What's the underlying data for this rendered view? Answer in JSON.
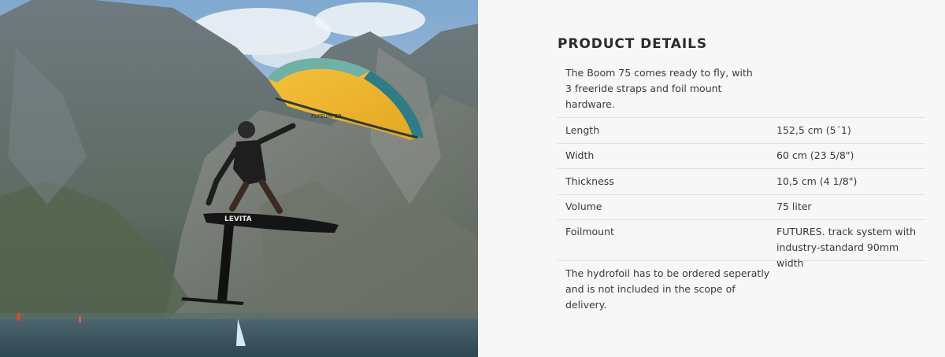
{
  "hero": {
    "board_brand": "LEVITA",
    "wing_brand": "FLYSURFER"
  },
  "details": {
    "title": "PRODUCT DETAILS",
    "intro": "The Boom 75 comes ready to fly, with 3 freeride straps and foil mount hardware.",
    "specs": [
      {
        "label": "Length",
        "value": "152,5 cm (5´1)"
      },
      {
        "label": "Width",
        "value": "60 cm (23 5/8\")"
      },
      {
        "label": "Thickness",
        "value": "10,5 cm (4 1/8\")"
      },
      {
        "label": "Volume",
        "value": "75 liter"
      },
      {
        "label": "Foilmount",
        "value": "FUTURES. track system with industry-standard 90mm width"
      }
    ],
    "note": "The hydrofoil has to be ordered seperatly and is not included in the scope of delivery."
  }
}
